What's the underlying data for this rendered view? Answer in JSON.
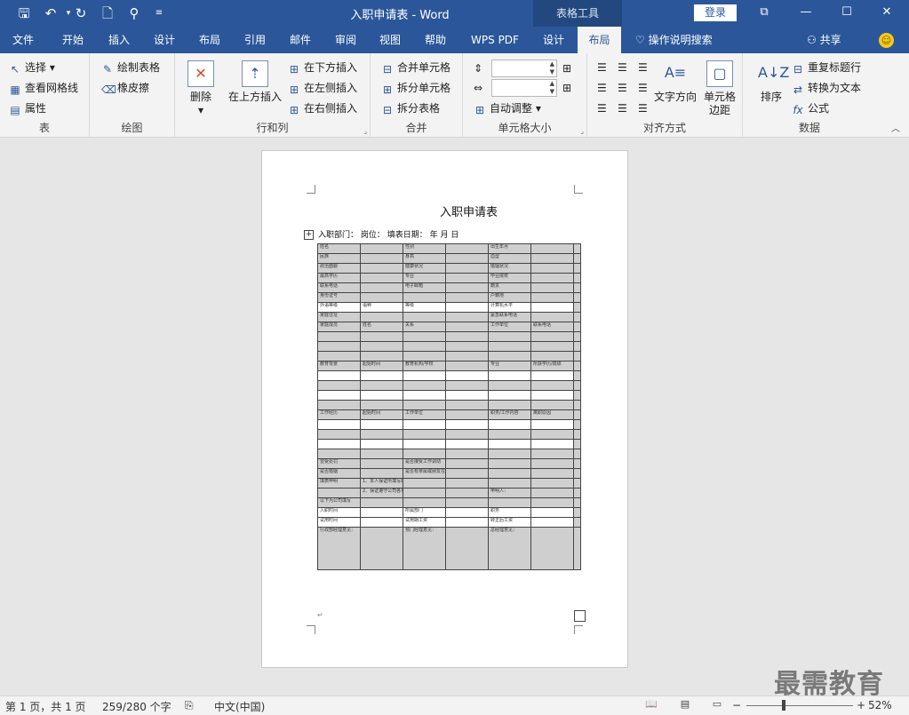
{
  "titlebar": {
    "doc_title": "入职申请表 - Word",
    "contextual_group": "表格工具",
    "login": "登录",
    "icons": [
      "save-icon",
      "undo-icon",
      "redo-icon",
      "new-doc-icon",
      "find-icon",
      "customize-qat-icon",
      "ribbon-display-icon",
      "minimize-icon",
      "maximize-icon",
      "close-icon"
    ]
  },
  "tabs": [
    "文件",
    "开始",
    "插入",
    "设计",
    "布局",
    "引用",
    "邮件",
    "审阅",
    "视图",
    "帮助",
    "WPS PDF",
    "设计",
    "布局"
  ],
  "active_tab_index": 12,
  "tellme": "操作说明搜索",
  "share": "共享",
  "ribbon": {
    "groups": {
      "table": {
        "name": "表",
        "select": "选择",
        "gridlines": "查看网格线",
        "properties": "属性"
      },
      "draw": {
        "name": "绘图",
        "draw_table": "绘制表格",
        "eraser": "橡皮擦"
      },
      "rows_cols": {
        "name": "行和列",
        "delete": "删除",
        "insert_above": "在上方插入",
        "insert_below": "在下方插入",
        "insert_left": "在左侧插入",
        "insert_right": "在右侧插入"
      },
      "merge": {
        "name": "合并",
        "merge_cells": "合并单元格",
        "split_cells": "拆分单元格",
        "split_table": "拆分表格"
      },
      "cell_size": {
        "name": "单元格大小",
        "height_value": "",
        "width_value": "",
        "autofit": "自动调整"
      },
      "alignment": {
        "name": "对齐方式",
        "text_direction": "文字方向",
        "cell_margins": "单元格边距"
      },
      "data": {
        "name": "数据",
        "sort": "排序",
        "repeat_header": "重复标题行",
        "convert_text": "转换为文本",
        "formula": "公式"
      }
    }
  },
  "document": {
    "title": "入职申请表",
    "meta": "入职部门：     岗位：    填表日期：     年     月     日",
    "table_rows": [
      {
        "s": 1,
        "c": [
          "姓名",
          "",
          "性别",
          "",
          "出生年月",
          "",
          ""
        ]
      },
      {
        "s": 1,
        "c": [
          "民族",
          "",
          "身高",
          "",
          "血型",
          "",
          ""
        ]
      },
      {
        "s": 1,
        "c": [
          "政治面貌",
          "",
          "健康状况",
          "",
          "婚姻状况",
          "",
          ""
        ]
      },
      {
        "s": 1,
        "c": [
          "最高学历",
          "",
          "专业",
          "",
          "毕业院校",
          "",
          ""
        ]
      },
      {
        "s": 1,
        "c": [
          "联系电话",
          "",
          "电子邮箱",
          "",
          "籍贯",
          "",
          ""
        ]
      },
      {
        "s": 1,
        "c": [
          "身份证号",
          "",
          "",
          "",
          "户籍地",
          "",
          ""
        ]
      },
      {
        "s": 0,
        "c": [
          "外语等级",
          "语种",
          "等级",
          "",
          "计算机水平",
          "",
          ""
        ]
      },
      {
        "s": 1,
        "c": [
          "家庭住址",
          "",
          "",
          "",
          "紧急联系电话",
          "",
          ""
        ]
      },
      {
        "s": 1,
        "c": [
          "家庭成员",
          "姓名",
          "关系",
          "",
          "工作单位",
          "联系电话",
          ""
        ]
      },
      {
        "s": 1,
        "c": [
          "",
          "",
          "",
          "",
          "",
          "",
          ""
        ]
      },
      {
        "s": 1,
        "c": [
          "",
          "",
          "",
          "",
          "",
          "",
          ""
        ]
      },
      {
        "s": 1,
        "c": [
          "",
          "",
          "",
          "",
          "",
          "",
          ""
        ]
      },
      {
        "s": 1,
        "c": [
          "教育背景",
          "起始时间",
          "教育机构/学校",
          "",
          "专业",
          "所获学历/成绩",
          ""
        ]
      },
      {
        "s": 0,
        "c": [
          "",
          "",
          "",
          "",
          "",
          "",
          ""
        ]
      },
      {
        "s": 1,
        "c": [
          "",
          "",
          "",
          "",
          "",
          "",
          ""
        ]
      },
      {
        "s": 0,
        "c": [
          "",
          "",
          "",
          "",
          "",
          "",
          ""
        ]
      },
      {
        "s": 1,
        "c": [
          "",
          "",
          "",
          "",
          "",
          "",
          ""
        ]
      },
      {
        "s": 1,
        "c": [
          "工作经历",
          "起始时间",
          "工作单位",
          "",
          "职务/工作内容",
          "离职原因",
          ""
        ]
      },
      {
        "s": 0,
        "c": [
          "",
          "",
          "",
          "",
          "",
          "",
          ""
        ]
      },
      {
        "s": 1,
        "c": [
          "",
          "",
          "",
          "",
          "",
          "",
          ""
        ]
      },
      {
        "s": 0,
        "c": [
          "",
          "",
          "",
          "",
          "",
          "",
          ""
        ]
      },
      {
        "s": 1,
        "c": [
          "",
          "",
          "",
          "",
          "",
          "",
          ""
        ]
      },
      {
        "s": 1,
        "c": [
          "曾受处罚",
          "",
          "是否接受工作调动",
          "",
          "",
          "",
          ""
        ]
      },
      {
        "s": 1,
        "c": [
          "是否婚姻",
          "",
          "是否有亲属或朋友在公司（姓名）",
          "",
          "",
          "",
          ""
        ]
      },
      {
        "s": 1,
        "c": [
          "填表申明",
          "1、本人保证所填写的材料属实",
          "",
          "",
          "",
          "",
          ""
        ]
      },
      {
        "s": 1,
        "c": [
          "",
          "2、保证遵守公司各项管理制度",
          "",
          "",
          "申明人：",
          "",
          ""
        ]
      },
      {
        "s": 1,
        "c": [
          "以下为公司填写",
          "",
          "",
          "",
          "",
          "",
          ""
        ]
      },
      {
        "s": 0,
        "c": [
          "入职时间",
          "",
          "所属部门",
          "",
          "职务",
          "",
          ""
        ]
      },
      {
        "s": 0,
        "c": [
          "试用时间",
          "",
          "试用期工资",
          "",
          "转正后工资",
          "",
          ""
        ]
      },
      {
        "s": 1,
        "c": [
          "行政部经理意见：",
          "",
          "预门经理意见：",
          "",
          "总经理意见：",
          "",
          ""
        ]
      }
    ]
  },
  "status": {
    "page": "第 1 页，共 1 页",
    "words": "259/280 个字",
    "lang": "中文(中国)",
    "zoom": "52%"
  },
  "watermark": "最需教育"
}
